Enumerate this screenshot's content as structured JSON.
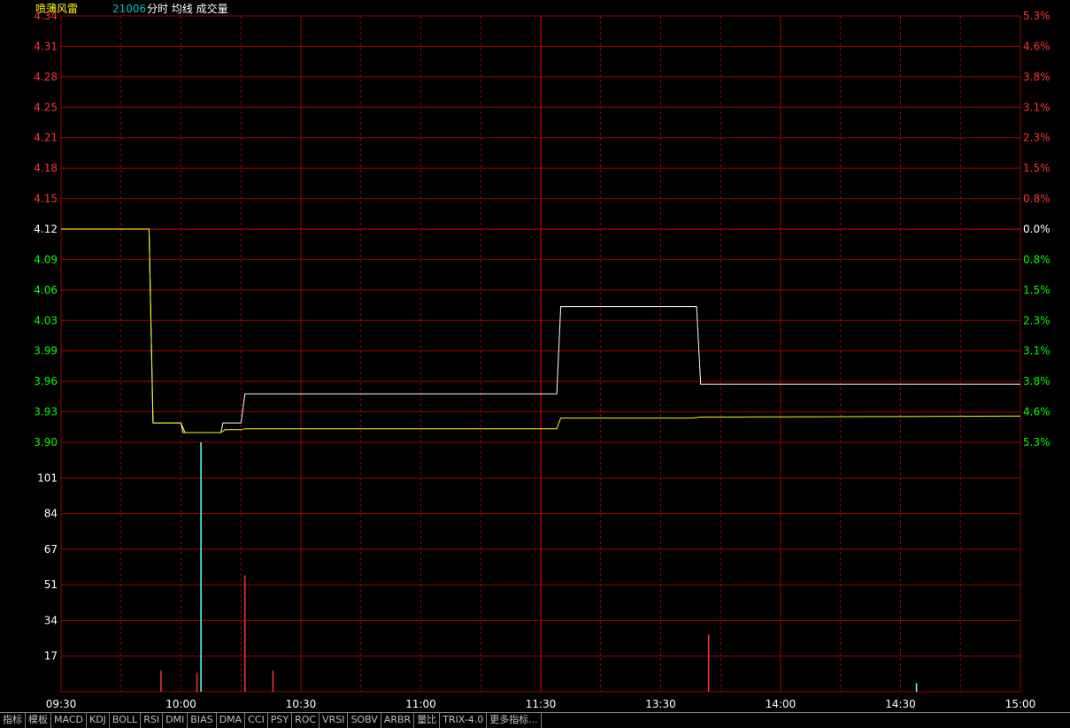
{
  "header": {
    "stock_name": "喷薄风雷",
    "code": "21006",
    "indicators": "分时 均线 成交量"
  },
  "colors": {
    "background": "#000000",
    "grid": "#a00000",
    "up_text": "#ff3232",
    "down_text": "#00ff00",
    "flat_text": "#ffffff",
    "price_line": "#ffffff",
    "avg_line": "#ffff00",
    "vol_up": "#ff3232",
    "vol_down": "#54ffff",
    "axis_text": "#ffffff",
    "header_name": "#ffff00",
    "header_code": "#00c0c0"
  },
  "chart_data": {
    "type": "line",
    "time_labels": [
      "09:30",
      "10:00",
      "10:30",
      "11:00",
      "11:30",
      "13:30",
      "14:00",
      "14:30",
      "15:00"
    ],
    "price_axis": {
      "up_ticks": [
        "4.34",
        "4.31",
        "4.28",
        "4.25",
        "4.21",
        "4.18",
        "4.15"
      ],
      "flat_tick": "4.12",
      "down_ticks": [
        "4.09",
        "4.06",
        "4.03",
        "3.99",
        "3.96",
        "3.93",
        "3.90"
      ],
      "ylim": [
        3.9,
        4.34
      ],
      "prev_close": 4.12
    },
    "percent_axis": {
      "up_ticks": [
        "5.3%",
        "4.6%",
        "3.8%",
        "3.1%",
        "2.3%",
        "1.5%",
        "0.8%"
      ],
      "flat_tick": "0.0%",
      "down_ticks": [
        "0.8%",
        "1.5%",
        "2.3%",
        "3.1%",
        "3.8%",
        "4.6%",
        "5.3%"
      ]
    },
    "volume_axis": {
      "ticks": [
        "101",
        "84",
        "67",
        "51",
        "34",
        "17"
      ],
      "ylim": [
        0,
        118
      ]
    },
    "series": [
      {
        "name": "分时",
        "x": [
          0,
          22,
          23,
          30,
          30.5,
          31,
          40,
          40.5,
          41,
          45,
          46,
          124,
          125,
          158,
          159,
          160,
          240
        ],
        "values": [
          4.12,
          4.12,
          3.92,
          3.92,
          3.91,
          3.91,
          3.91,
          3.92,
          3.92,
          3.92,
          3.95,
          3.95,
          4.04,
          4.04,
          4.04,
          3.96,
          3.96
        ]
      },
      {
        "name": "均线",
        "x": [
          0,
          22,
          23,
          30,
          31,
          40,
          41,
          45,
          46,
          124,
          125,
          158,
          160,
          240
        ],
        "values": [
          4.12,
          4.12,
          3.92,
          3.92,
          3.91,
          3.91,
          3.913,
          3.913,
          3.914,
          3.914,
          3.925,
          3.925,
          3.926,
          3.927
        ]
      }
    ],
    "volume_bars": [
      {
        "x": 25,
        "value": 10,
        "dir": "up"
      },
      {
        "x": 34,
        "value": 9,
        "dir": "up"
      },
      {
        "x": 35,
        "value": 118,
        "dir": "down"
      },
      {
        "x": 46,
        "value": 55,
        "dir": "up"
      },
      {
        "x": 53,
        "value": 10,
        "dir": "up"
      },
      {
        "x": 162,
        "value": 27,
        "dir": "up"
      },
      {
        "x": 214,
        "value": 4,
        "dir": "down"
      }
    ]
  },
  "toolbar": {
    "tabs": [
      "指标",
      "模板",
      "MACD",
      "KDJ",
      "BOLL",
      "RSI",
      "DMI",
      "BIAS",
      "DMA",
      "CCI",
      "PSY",
      "ROC",
      "VRSI",
      "SOBV",
      "ARBR",
      "量比",
      "TRIX-4.0",
      "更多指标..."
    ]
  }
}
